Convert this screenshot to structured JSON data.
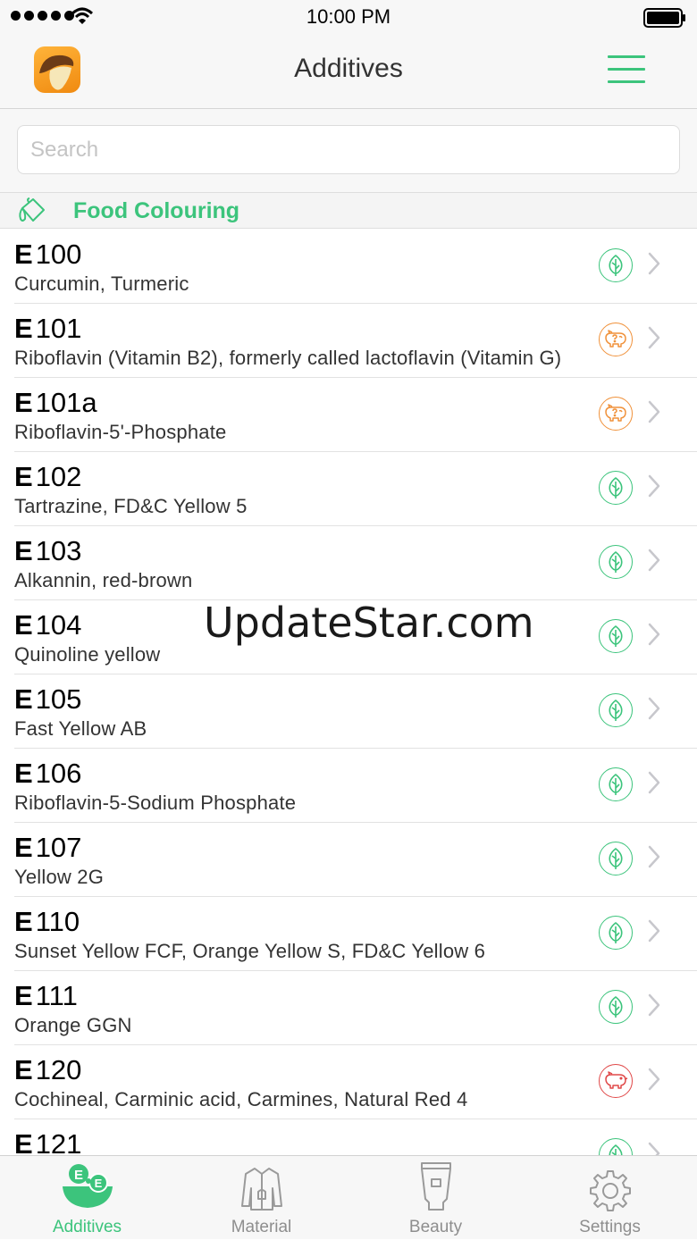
{
  "status_bar": {
    "time": "10:00 PM"
  },
  "nav": {
    "title": "Additives"
  },
  "search": {
    "placeholder": "Search"
  },
  "section": {
    "title": "Food Colouring"
  },
  "colors": {
    "accent": "#3cc47c",
    "vegan": "#3cc47c",
    "uncertain": "#f0913a",
    "animal": "#e04848"
  },
  "items": [
    {
      "prefix": "E",
      "number": "100",
      "description": "Curcumin, Turmeric",
      "status": "vegan",
      "icon": "leaf-icon"
    },
    {
      "prefix": "E",
      "number": "101",
      "description": "Riboflavin (Vitamin B2), formerly called lactoflavin (Vitamin G)",
      "status": "uncertain",
      "icon": "pig-question-icon"
    },
    {
      "prefix": "E",
      "number": "101a",
      "description": "Riboflavin-5'-Phosphate",
      "status": "uncertain",
      "icon": "pig-question-icon"
    },
    {
      "prefix": "E",
      "number": "102",
      "description": "Tartrazine, FD&C Yellow 5",
      "status": "vegan",
      "icon": "leaf-icon"
    },
    {
      "prefix": "E",
      "number": "103",
      "description": "Alkannin, red-brown",
      "status": "vegan",
      "icon": "leaf-icon"
    },
    {
      "prefix": "E",
      "number": "104",
      "description": "Quinoline yellow",
      "status": "vegan",
      "icon": "leaf-icon"
    },
    {
      "prefix": "E",
      "number": "105",
      "description": "Fast Yellow AB",
      "status": "vegan",
      "icon": "leaf-icon"
    },
    {
      "prefix": "E",
      "number": "106",
      "description": "Riboflavin-5-Sodium Phosphate",
      "status": "vegan",
      "icon": "leaf-icon"
    },
    {
      "prefix": "E",
      "number": "107",
      "description": "Yellow 2G",
      "status": "vegan",
      "icon": "leaf-icon"
    },
    {
      "prefix": "E",
      "number": "110",
      "description": "Sunset Yellow FCF, Orange Yellow S, FD&C Yellow 6",
      "status": "vegan",
      "icon": "leaf-icon"
    },
    {
      "prefix": "E",
      "number": "111",
      "description": "Orange GGN",
      "status": "vegan",
      "icon": "leaf-icon"
    },
    {
      "prefix": "E",
      "number": "120",
      "description": "Cochineal, Carminic acid, Carmines, Natural Red 4",
      "status": "animal",
      "icon": "pig-icon"
    },
    {
      "prefix": "E",
      "number": "121",
      "description": "",
      "status": "vegan",
      "icon": "leaf-icon"
    }
  ],
  "tabs": [
    {
      "label": "Additives",
      "icon": "additives-bowl-icon",
      "active": true
    },
    {
      "label": "Material",
      "icon": "jacket-icon",
      "active": false
    },
    {
      "label": "Beauty",
      "icon": "cream-tube-icon",
      "active": false
    },
    {
      "label": "Settings",
      "icon": "gear-icon",
      "active": false
    }
  ],
  "watermark": "UpdateStar.com"
}
